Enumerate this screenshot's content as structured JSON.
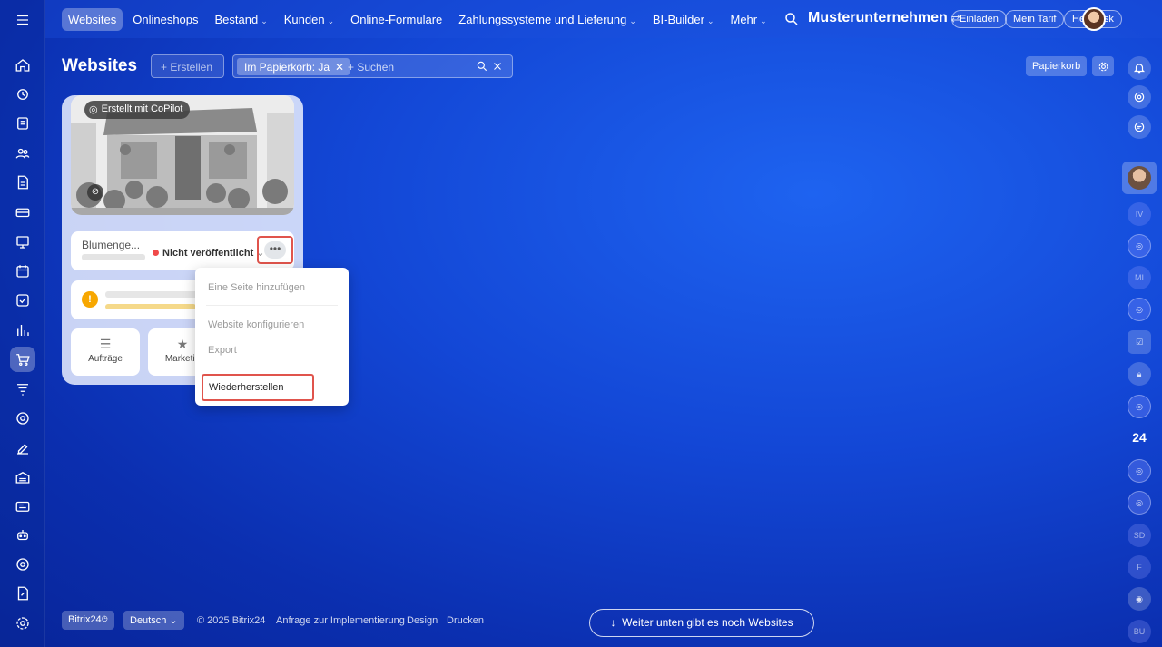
{
  "topnav": {
    "items": [
      {
        "label": "Websites",
        "has_menu": false
      },
      {
        "label": "Onlineshops",
        "has_menu": false
      },
      {
        "label": "Bestand",
        "has_menu": true
      },
      {
        "label": "Kunden",
        "has_menu": true
      },
      {
        "label": "Online-Formulare",
        "has_menu": false
      },
      {
        "label": "Zahlungssysteme und Lieferung",
        "has_menu": true
      },
      {
        "label": "BI-Builder",
        "has_menu": true
      },
      {
        "label": "Mehr",
        "has_menu": true
      }
    ],
    "company": "Musterunternehmen",
    "invite": "Einladen",
    "plan": "Mein Tarif",
    "helpdesk": "Helpdesk"
  },
  "page": {
    "title": "Websites",
    "create_label": "+ Erstellen",
    "filter_tag": "Im Papierkorb: Ja",
    "search_placeholder": "+ Suchen",
    "trash_label": "Papierkorb"
  },
  "card": {
    "badge": "Erstellt mit CoPilot",
    "site_name": "Blumenge...",
    "status": "Nicht veröffentlicht",
    "more": "•••",
    "tiles": [
      {
        "label": "Aufträge",
        "icon": "funnel-icon"
      },
      {
        "label": "Marketin",
        "icon": "star-icon"
      }
    ]
  },
  "dropdown": {
    "items": [
      "Eine Seite hinzufügen",
      "Website konfigurieren",
      "Export"
    ],
    "restore": "Wiederherstellen"
  },
  "right_sidebar": {
    "initials": [
      "IV",
      "MI",
      "SD",
      "F",
      "BU"
    ],
    "badge_24": "24"
  },
  "footer": {
    "brand": "Bitrix24",
    "language": "Deutsch",
    "copyright": "© 2025 Bitrix24",
    "links": [
      "Anfrage zur Implementierung",
      "Design",
      "Drucken"
    ],
    "more_sites": "Weiter unten gibt es noch Websites"
  }
}
